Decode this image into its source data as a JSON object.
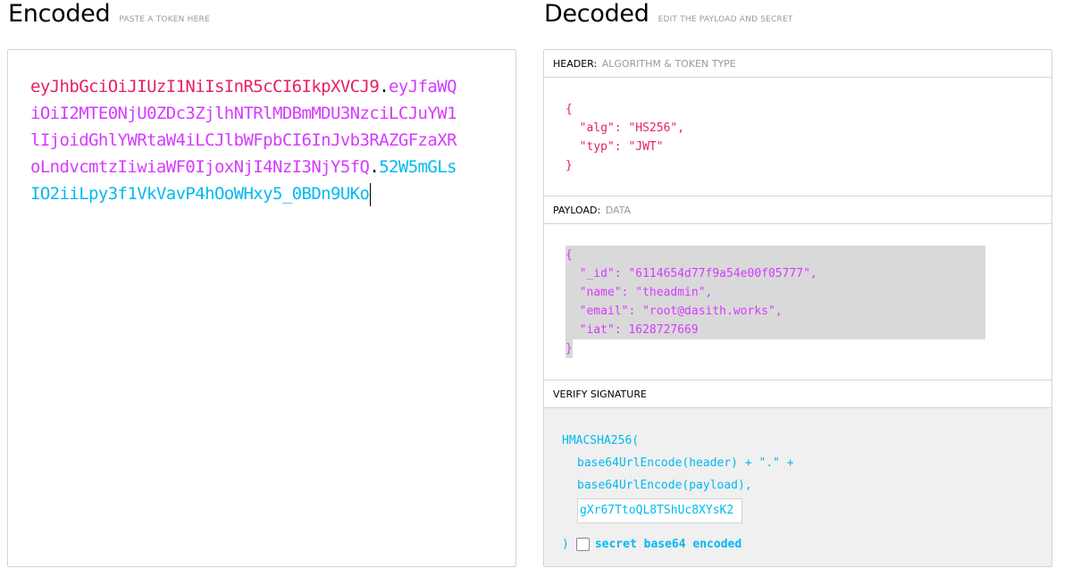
{
  "encoded": {
    "title": "Encoded",
    "subtitle": "PASTE A TOKEN HERE",
    "token_header": "eyJhbGciOiJIUzI1NiIsInR5cCI6IkpXVCJ9",
    "token_payload": "eyJfaWQiOiI2MTE0NjU0ZDc3ZjlhNTRlMDBmMDU3NzciLCJuYW1lIjoidGhlYWRtaW4iLCJlbWFpbCI6InJvb3RAZGFzaXRoLndvcmtzIiwiaWF0IjoxNjI4NzI3NjY5fQ",
    "token_signature": "52W5mGLsIO2iiLpy3f1VkVavP4hOoWHxy5_0BDn9UKo",
    "dot": "."
  },
  "decoded": {
    "title": "Decoded",
    "subtitle": "EDIT THE PAYLOAD AND SECRET",
    "header_section": {
      "label": "HEADER:",
      "sublabel": "ALGORITHM & TOKEN TYPE",
      "json_text": "{\n  \"alg\": \"HS256\",\n  \"typ\": \"JWT\"\n}"
    },
    "payload_section": {
      "label": "PAYLOAD:",
      "sublabel": "DATA",
      "json_text": "{\n  \"_id\": \"6114654d77f9a54e00f05777\",\n  \"name\": \"theadmin\",\n  \"email\": \"root@dasith.works\",\n  \"iat\": 1628727669\n}"
    },
    "verify_section": {
      "label": "VERIFY SIGNATURE",
      "line1": "HMACSHA256(",
      "line2": "base64UrlEncode(header) + \".\" +",
      "line3": "base64UrlEncode(payload),",
      "secret_value": "gXr67TtoQL8TShUc8XYsK2",
      "close": ")",
      "checkbox_label": "secret base64 encoded"
    }
  },
  "colors": {
    "header": "#e91e63",
    "payload": "#d63aff",
    "signature": "#00b9f1"
  }
}
